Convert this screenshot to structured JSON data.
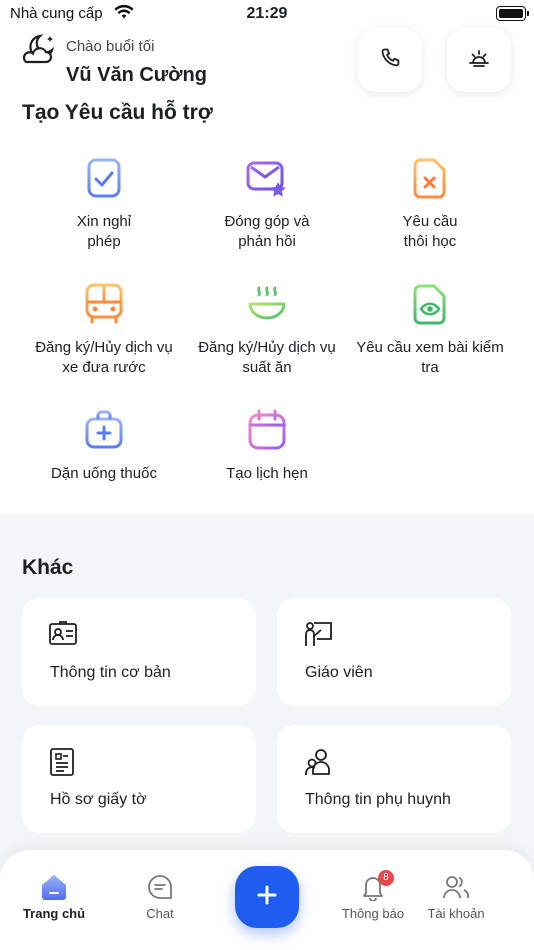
{
  "status_bar": {
    "carrier": "Nhà cung cấp",
    "time": "21:29"
  },
  "header": {
    "greeting": "Chào buổi tối",
    "user_name": "Vũ Văn Cường"
  },
  "support": {
    "title": "Tạo Yêu cầu hỗ trợ",
    "items": [
      {
        "line1": "Xin nghỉ",
        "line2": "phép",
        "icon": "checklist-icon"
      },
      {
        "line1": "Đóng góp và",
        "line2": "phản hồi",
        "icon": "mail-star-icon"
      },
      {
        "line1": "Yêu cầu",
        "line2": "thôi học",
        "icon": "document-x-icon"
      },
      {
        "line1": "Đăng ký/Hủy dịch vụ",
        "line2": "xe đưa rước",
        "icon": "bus-icon"
      },
      {
        "line1": "Đăng ký/Hủy dịch vụ",
        "line2": "suất ăn",
        "icon": "food-bowl-icon"
      },
      {
        "line1": "Yêu cầu xem bài kiểm",
        "line2": "tra",
        "icon": "document-eye-icon"
      },
      {
        "line1": "Dặn uống thuốc",
        "line2": "",
        "icon": "medical-kit-icon"
      },
      {
        "line1": "Tạo lịch hẹn",
        "line2": "",
        "icon": "calendar-icon"
      }
    ]
  },
  "other": {
    "title": "Khác",
    "cards": [
      {
        "label": "Thông tin cơ bản",
        "icon": "id-card-icon"
      },
      {
        "label": "Giáo viên",
        "icon": "teacher-icon"
      },
      {
        "label": "Hồ sơ giấy tờ",
        "icon": "document-list-icon"
      },
      {
        "label": "Thông tin phụ huynh",
        "icon": "parents-icon"
      }
    ]
  },
  "nav": {
    "home": "Trang chủ",
    "chat": "Chat",
    "notifications": "Thông báo",
    "notifications_badge": "8",
    "account": "Tài khoản"
  },
  "colors": {
    "accent": "#1f5cf0",
    "badge": "#e5484d"
  }
}
